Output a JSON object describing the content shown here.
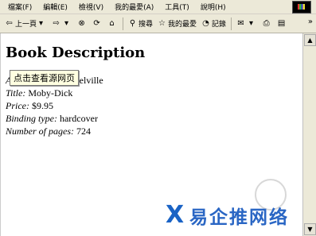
{
  "menubar": {
    "items": [
      "檔案(F)",
      "編輯(E)",
      "檢視(V)",
      "我的最愛(A)",
      "工具(T)",
      "說明(H)"
    ]
  },
  "toolbar": {
    "back_label": "上一頁",
    "search_label": "搜尋",
    "favorites_label": "我的最愛",
    "history_label": "記錄"
  },
  "page": {
    "heading": "Book Description",
    "fields": [
      {
        "key": "Author:",
        "value": "Herman Melville"
      },
      {
        "key": "Title:",
        "value": "Moby-Dick"
      },
      {
        "key": "Price:",
        "value": "$9.95"
      },
      {
        "key": "Binding type:",
        "value": "hardcover"
      },
      {
        "key": "Number of pages:",
        "value": "724"
      }
    ]
  },
  "tooltip": {
    "text": "点击查看源网页"
  },
  "watermark": {
    "text": "易企推网络"
  }
}
